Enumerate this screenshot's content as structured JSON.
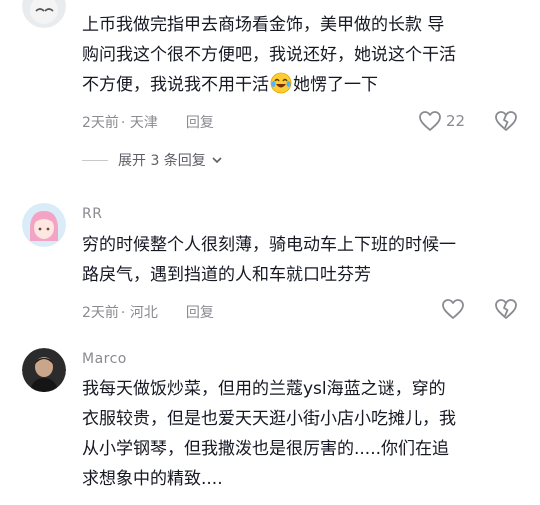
{
  "comments": [
    {
      "username": "",
      "text_line1": "上币我做完指甲去商场看金饰，美甲做的长款 导",
      "text_line2": "购问我这个很不方便吧，我说还好，她说这个干活",
      "text_line3_a": "不方便，我说我不用干活",
      "emoji": "laughing-tears-emoji",
      "text_line3_b": "她愣了一下",
      "time": "2天前",
      "location": "· 天津",
      "reply_label": "回复",
      "likes": "22",
      "expand_label": "展开 3 条回复"
    },
    {
      "username": "RR",
      "text_line1": "穷的时候整个人很刻薄，骑电动车上下班的时候一",
      "text_line2": "路戾气，遇到挡道的人和车就口吐芬芳",
      "time": "2天前",
      "location": "· 河北",
      "reply_label": "回复"
    },
    {
      "username": "Marco",
      "text_line1": "我每天做饭炒菜，但用的兰蔻ysl海蓝之谜，穿的",
      "text_line2": "衣服较贵，但是也爱天天逛小街小店小吃摊儿，我",
      "text_line3": "从小学钢琴，但我撒泼也是很厉害的.....你们在追",
      "text_line4": "求想象中的精致...."
    }
  ],
  "icons": {
    "like": "heart-outline-icon",
    "dislike": "broken-heart-icon",
    "expand": "chevron-down-icon"
  },
  "colors": {
    "text": "#161823",
    "meta": "#8a8b91",
    "icon": "#8a8b91"
  }
}
